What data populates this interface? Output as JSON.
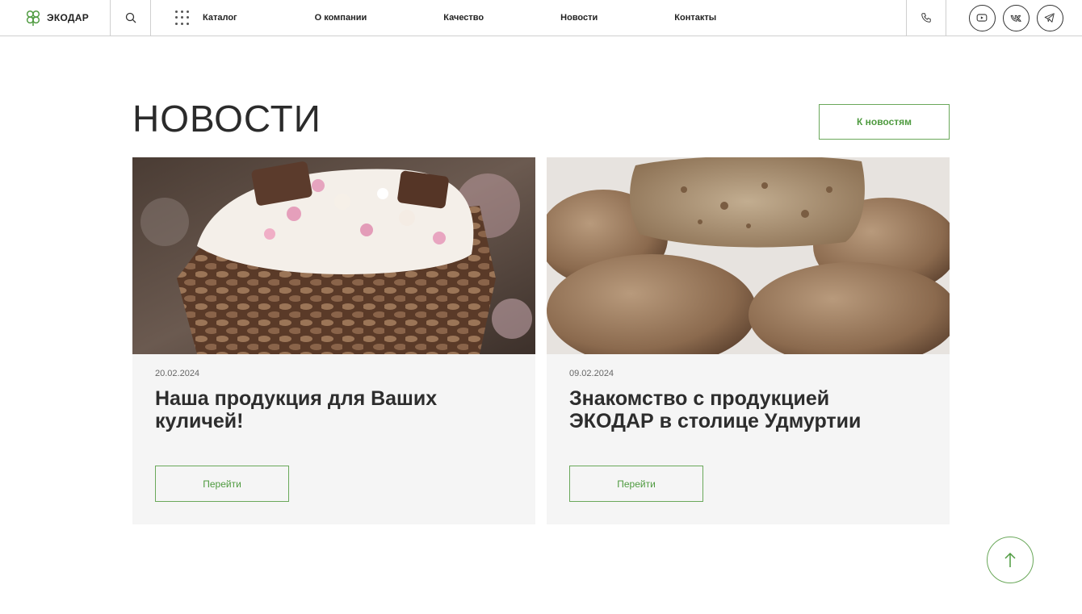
{
  "header": {
    "logo_text": "ЭКОДАР",
    "nav": [
      "Каталог",
      "О компании",
      "Качество",
      "Новости",
      "Контакты"
    ]
  },
  "section": {
    "title": "НОВОСТИ",
    "all_news_label": "К новостям"
  },
  "cards": [
    {
      "date": "20.02.2024",
      "title": "Наша продукция для Ваших куличей!",
      "button": "Перейти",
      "image": "easter-cake-photo"
    },
    {
      "date": "09.02.2024",
      "title": "Знакомство с продукцией ЭКОДАР в столице Удмуртии",
      "button": "Перейти",
      "image": "bread-loaves-photo"
    }
  ],
  "colors": {
    "accent": "#4e9a3f",
    "border": "#cfcfcf",
    "card_bg": "#f5f5f5"
  },
  "icons": [
    "clover-logo-icon",
    "search-icon",
    "grid-dots-icon",
    "phone-icon",
    "youtube-icon",
    "vk-icon",
    "telegram-icon",
    "arrow-up-icon"
  ]
}
